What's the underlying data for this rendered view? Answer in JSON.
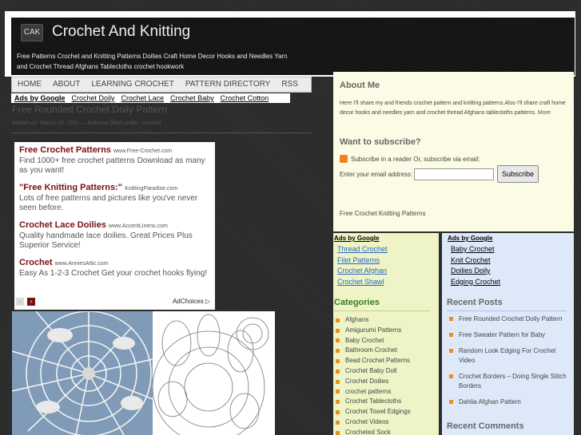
{
  "header": {
    "logo_text": "CAK",
    "title": "Crochet And Knitting",
    "tagline": "Free Patterns Crochet and Knitting Patterns Doilies Craft Home Decor Hooks and Needles Yarn and Crochet Thread Afghans Tablecloths crochet hookwork"
  },
  "nav": {
    "items": [
      "HOME",
      "ABOUT",
      "LEARNING CROCHET",
      "PATTERN DIRECTORY",
      "RSS"
    ]
  },
  "subnav": {
    "ads_label": "Ads by Google",
    "items": [
      "Crochet Doily",
      "Crochet Lace",
      "Crochet Baby",
      "Crochet Cotton"
    ]
  },
  "post": {
    "title": "Free Rounded Crochet Doily Pattern",
    "meta": "Written on: March 16, 2011 — Kathrine (filed under: crochet)"
  },
  "adbox": {
    "ads": [
      {
        "title": "Free Crochet Patterns",
        "url": "www.Free-Crochet.com",
        "desc": "Find 1000+ free crochet patterns Download as many as you want!"
      },
      {
        "title": "\"Free Knitting Patterns:\"",
        "url": "KnittingParadise.com",
        "desc": "Lots of free patterns and pictures like you've never seen before."
      },
      {
        "title": "Crochet Lace Doilies",
        "url": "www.AccentLinens.com",
        "desc": "Quality handmade lace doilies. Great Prices Plus Superior Service!"
      },
      {
        "title": "Crochet",
        "url": "www.AnniesAttic.com",
        "desc": "Easy As 1-2-3 Crochet Get your crochet hooks flying!"
      }
    ],
    "adchoices": "AdChoices ▷",
    "prev": "‹",
    "next": "›"
  },
  "sidebar": {
    "about_heading": "About Me",
    "about_text": "Here I'll share my and friends crochet pattern and knitting patterns.Also I'll share craft home decor hooks and needles yarn and crochet thread Afghans tablecloths patterns.",
    "about_more": "More",
    "subscribe_heading": "Want to subscribe?",
    "rss_text": "Subscribe in a reader Or, subscribe via email:",
    "email_label": "Enter your email address:",
    "subscribe_button": "Subscribe",
    "free_text": "Free Crochet Knitting Patterns",
    "ads_left": {
      "heading": "Ads by Google",
      "links": [
        "Thread Crochet",
        "Filet Patterns",
        "Crochet Afghan",
        "Crochet Shawl"
      ]
    },
    "ads_right": {
      "heading": "Ads by Google",
      "links": [
        "Baby Crochet",
        "Knit Crochet",
        "Doilies Doily",
        "Edging Crochet"
      ]
    },
    "categories_heading": "Categories",
    "categories": [
      "Afghans",
      "Amigurumi Patterns",
      "Baby Crochet",
      "Bathroom Crochet",
      "Bead Crochet Patterns",
      "Crochet Baby Doll",
      "Crochet Doilies",
      "crochet patterns",
      "Crochet Tablecloths",
      "Crochet Towel Edgings",
      "Crochet Videos",
      "Crocheted Sock"
    ],
    "recent_heading": "Recent Posts",
    "recent_posts": [
      "Free Rounded Crochet Doily Pattern",
      "Free Sweater Pattern for Baby",
      "Random Look Edging For Crochet Video",
      "Crochet Borders – Doing Single Stitch Borders",
      "Dahlia Afghan Pattern"
    ],
    "comments_heading": "Recent Comments"
  },
  "colors": {
    "ad_title": "#7a1010",
    "category_heading": "#3a7a1c",
    "bullet": "#e8901c",
    "link_blue": "#2b66c8"
  }
}
